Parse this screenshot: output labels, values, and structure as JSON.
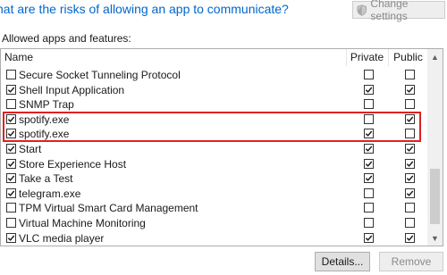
{
  "header": {
    "question_link": "hat are the risks of allowing an app to communicate?",
    "change_settings_label": "Change settings",
    "change_settings_icon": "uac-shield-icon"
  },
  "section": {
    "label": "Allowed apps and features:"
  },
  "columns": {
    "name": "Name",
    "private": "Private",
    "public": "Public"
  },
  "rows": [
    {
      "name": "Secure Socket Tunneling Protocol",
      "enabled": false,
      "private": false,
      "public": false
    },
    {
      "name": "Shell Input Application",
      "enabled": true,
      "private": true,
      "public": true
    },
    {
      "name": "SNMP Trap",
      "enabled": false,
      "private": false,
      "public": false
    },
    {
      "name": "spotify.exe",
      "enabled": true,
      "private": false,
      "public": true
    },
    {
      "name": "spotify.exe",
      "enabled": true,
      "private": true,
      "public": false
    },
    {
      "name": "Start",
      "enabled": true,
      "private": true,
      "public": true
    },
    {
      "name": "Store Experience Host",
      "enabled": true,
      "private": true,
      "public": true
    },
    {
      "name": "Take a Test",
      "enabled": true,
      "private": true,
      "public": true
    },
    {
      "name": "telegram.exe",
      "enabled": true,
      "private": false,
      "public": true
    },
    {
      "name": "TPM Virtual Smart Card Management",
      "enabled": false,
      "private": false,
      "public": false
    },
    {
      "name": "Virtual Machine Monitoring",
      "enabled": false,
      "private": false,
      "public": false
    },
    {
      "name": "VLC media player",
      "enabled": true,
      "private": true,
      "public": true
    }
  ],
  "buttons": {
    "details": "Details...",
    "remove": "Remove"
  },
  "colors": {
    "link": "#0066cc",
    "highlight_border": "#e02020"
  }
}
